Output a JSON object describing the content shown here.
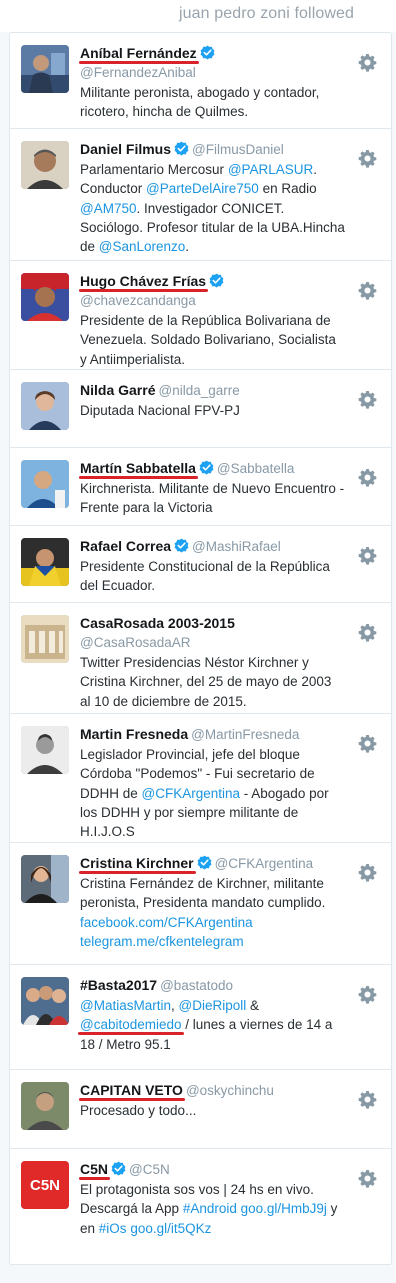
{
  "header": {
    "title": "juan pedro zoni followed"
  },
  "colors": {
    "accent": "#1b95e0",
    "verified": "#1da1f2",
    "underline": "#d8232a",
    "muted": "#8899a6"
  },
  "icons": {
    "verified": "verified-badge-icon",
    "gear": "gear-icon"
  },
  "users": [
    {
      "name": "Aníbal Fernández",
      "handle": "@FernandezAnibal",
      "bio": "Militante peronista, abogado y contador, ricotero, hincha de Quilmes."
    },
    {
      "name": "Daniel Filmus",
      "handle": "@FilmusDaniel",
      "bio_parts": [
        "Parlamentario Mercosur ",
        "@PARLASUR",
        ". Conductor ",
        "@ParteDelAire750",
        " en Radio ",
        "@AM750",
        ". Investigador CONICET. Sociólogo. Profesor titular de la UBA.Hincha de ",
        "@SanLorenzo",
        "."
      ]
    },
    {
      "name": "Hugo Chávez Frías",
      "handle": "@chavezcandanga",
      "bio": "Presidente de la República Bolivariana de Venezuela. Soldado Bolivariano, Socialista y Antiimperialista."
    },
    {
      "name": "Nilda Garré",
      "handle": "@nilda_garre",
      "bio": "Diputada Nacional FPV-PJ"
    },
    {
      "name": "Martín Sabbatella",
      "handle": "@Sabbatella",
      "bio": "Kirchnerista. Militante de Nuevo Encuentro - Frente para la Victoria"
    },
    {
      "name": "Rafael Correa",
      "handle": "@MashiRafael",
      "bio": "Presidente Constitucional de la República del Ecuador."
    },
    {
      "name": "CasaRosada 2003-2015",
      "handle": "@CasaRosadaAR",
      "bio": "Twitter Presidencias Néstor Kirchner y Cristina Kirchner, del 25 de mayo de 2003 al 10 de diciembre de 2015."
    },
    {
      "name": "Martin Fresneda",
      "handle": "@MartinFresneda",
      "bio_parts": [
        "Legislador Provincial, jefe del bloque Córdoba \"Podemos\" - Fui secretario de DDHH de ",
        "@CFKArgentina",
        " - Abogado por los DDHH y por siempre militante de H.I.J.O.S"
      ]
    },
    {
      "name": "Cristina Kirchner",
      "handle": "@CFKArgentina",
      "bio": "Cristina Fernández de Kirchner, militante peronista, Presidenta mandato cumplido.",
      "links": [
        "facebook.com/CFKArgentina",
        "telegram.me/cfkentelegram"
      ]
    },
    {
      "name": "#Basta2017",
      "handle": "@bastatodo",
      "bio_parts": [
        "@MatiasMartin",
        ", ",
        "@DieRipoll",
        " & ",
        "@cabitodemiedo",
        " / lunes a viernes de 14 a 18 / Metro 95.1"
      ]
    },
    {
      "name": "CAPITAN VETO",
      "handle": "@oskychinchu",
      "bio": "Procesado y todo..."
    },
    {
      "name": "C5N",
      "handle": "@C5N",
      "bio_parts": [
        "El protagonista sos vos | 24 hs en vivo. Descargá la App ",
        "#Android",
        " ",
        "goo.gl/HmbJ9j",
        " y en ",
        "#iOs",
        " ",
        "goo.gl/it5QKz"
      ]
    }
  ]
}
